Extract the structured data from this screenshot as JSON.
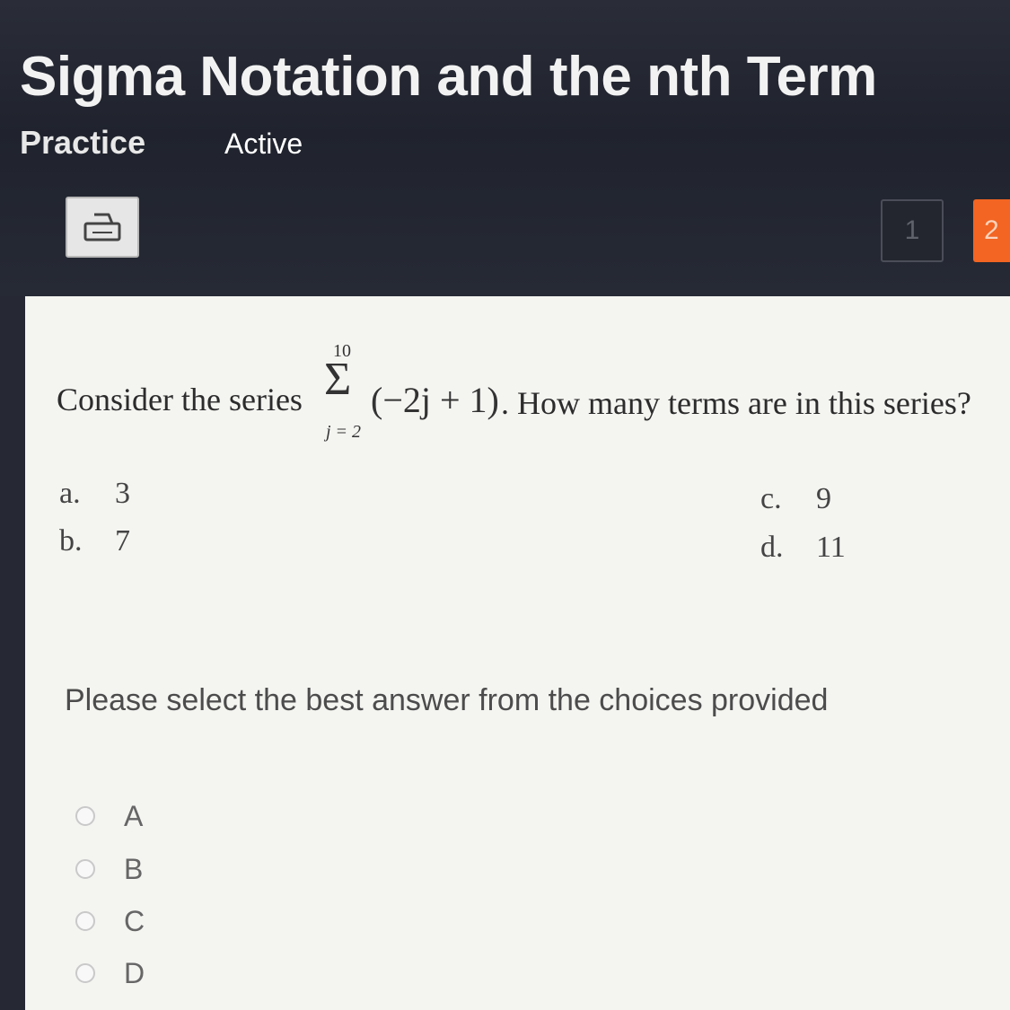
{
  "header": {
    "title": "Sigma Notation and the nth Term",
    "tabs": [
      {
        "label": "Practice"
      },
      {
        "label": "Active"
      }
    ],
    "pagination": [
      {
        "label": "1"
      },
      {
        "label": "2"
      }
    ]
  },
  "question": {
    "prefix": "Consider the series",
    "sigma_symbol": "Σ",
    "sigma_upper": "10",
    "sigma_lower": "j = 2",
    "term": "(−2j + 1)",
    "suffix": ". How many terms are in this series?",
    "choices": [
      {
        "letter": "a.",
        "value": "3"
      },
      {
        "letter": "b.",
        "value": "7"
      },
      {
        "letter": "c.",
        "value": "9"
      },
      {
        "letter": "d.",
        "value": "11"
      }
    ]
  },
  "instruction": "Please select the best answer from the choices provided",
  "answer_options": [
    {
      "label": "A",
      "selected": false
    },
    {
      "label": "B",
      "selected": false
    },
    {
      "label": "C",
      "selected": false
    },
    {
      "label": "D",
      "selected": false
    }
  ],
  "colors": {
    "accent": "#f26522",
    "header_bg": "#20232d",
    "content_bg": "#f4f4f1"
  },
  "icons": {
    "print": "printer-icon"
  }
}
